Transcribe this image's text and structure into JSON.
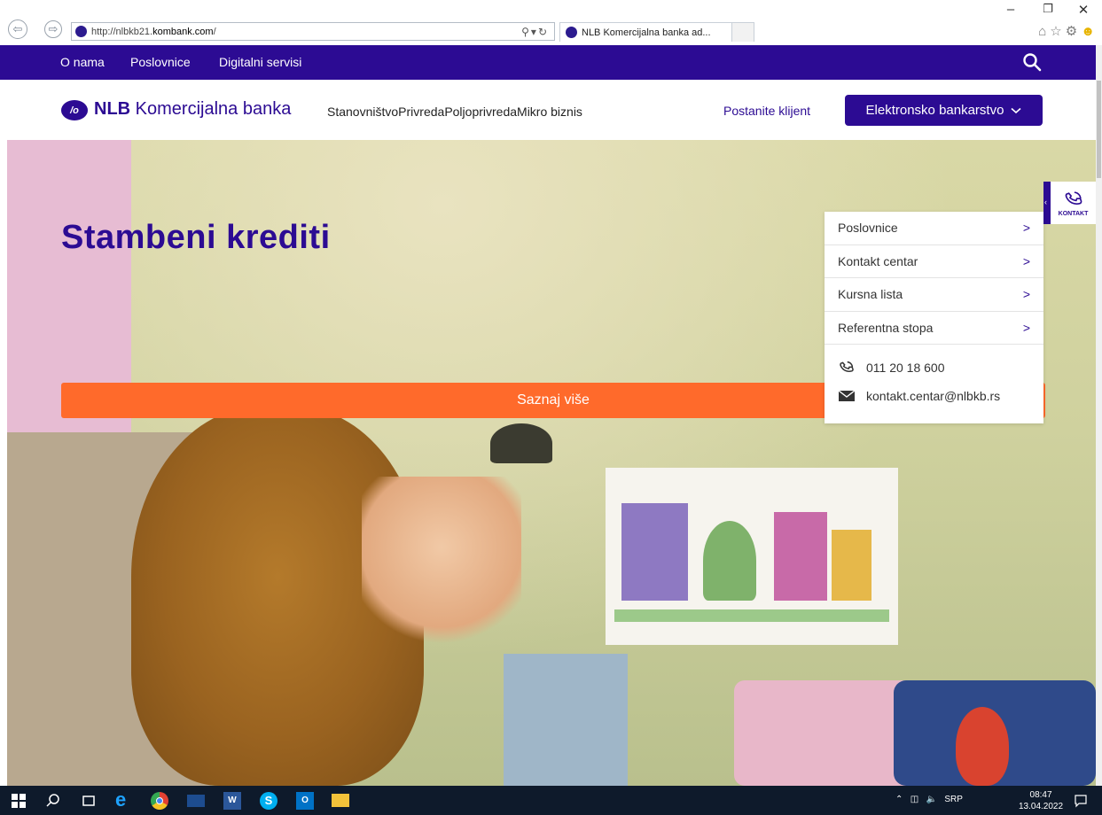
{
  "browser": {
    "url_prefix": "http://nlbkb21.",
    "url_domain": "kombank.com",
    "url_suffix": "/",
    "tab_title": "NLB Komercijalna banka ad...",
    "tab_close": "×"
  },
  "topbar": {
    "links": [
      "O nama",
      "Poslovnice",
      "Digitalni servisi"
    ]
  },
  "header": {
    "logo_mark": "/o",
    "logo_bold": "NLB",
    "logo_rest": " Komercijalna banka",
    "nav": [
      "Stanovništvo",
      "Privreda",
      "Poljoprivreda",
      "Mikro biznis"
    ],
    "become_client": "Postanite klijent",
    "ebank_label": "Elektronsko bankarstvo"
  },
  "hero": {
    "title": "Stambeni krediti",
    "cta": "Saznaj više"
  },
  "contact": {
    "tab_label": "KONTAKT",
    "items": [
      "Poslovnice",
      "Kontakt centar",
      "Kursna lista",
      "Referentna stopa"
    ],
    "phone": "011 20 18 600",
    "email": "kontakt.centar@nlbkb.rs"
  },
  "taskbar": {
    "lang": "SRP",
    "time": "08:47",
    "date": "13.04.2022"
  },
  "colors": {
    "brand": "#2c0b93",
    "cta": "#ff6a2b"
  }
}
